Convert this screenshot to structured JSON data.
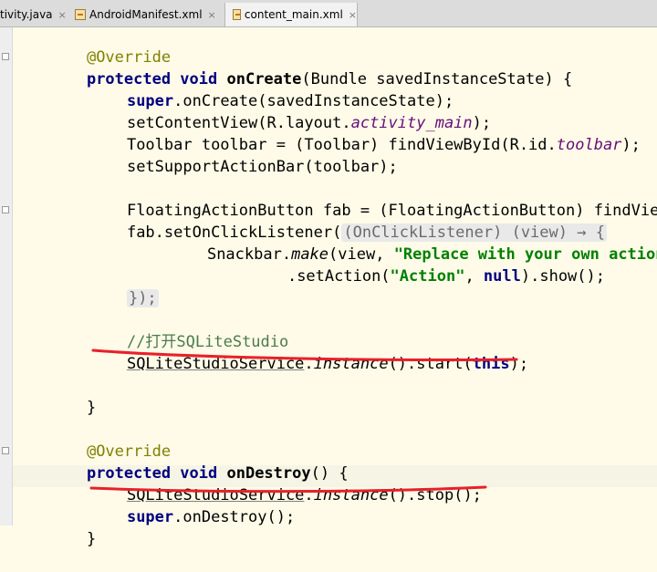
{
  "tabs": [
    {
      "label": "tivity.java",
      "icon": "java-file-icon",
      "active": false
    },
    {
      "label": "AndroidManifest.xml",
      "icon": "xml-file-icon",
      "active": false
    },
    {
      "label": "content_main.xml",
      "icon": "xml-file-icon",
      "active": true
    }
  ],
  "close_glyph": "×",
  "code": {
    "l1": "@Override",
    "l2_kw": "protected void ",
    "l2_name": "onCreate",
    "l2_rest": "(Bundle savedInstanceState) {",
    "l3_super": "super",
    "l3_rest": ".onCreate(savedInstanceState);",
    "l4_a": "setContentView(R.layout.",
    "l4_field": "activity_main",
    "l4_b": ");",
    "l5_a": "Toolbar toolbar = (Toolbar) findViewById(R.id.",
    "l5_field": "toolbar",
    "l5_b": ");",
    "l6": "setSupportActionBar(toolbar);",
    "l7": "FloatingActionButton fab = (FloatingActionButton) findViewBy",
    "l8_a": "fab.setOnClickListener(",
    "l8_hint": "(OnClickListener) (view) → {",
    "l9_a": "Snackbar.",
    "l9_make": "make",
    "l9_b": "(view, ",
    "l9_str": "\"Replace with your own action",
    "l10_a": ".setAction(",
    "l10_str": "\"Action\"",
    "l10_b": ", ",
    "l10_null": "null",
    "l10_c": ").show();",
    "l11": "});",
    "l12": "//打开SQLiteStudio",
    "l13_a": "SQLiteStudioService",
    "l13_b": ".",
    "l13_inst": "instance",
    "l13_c": "().start(",
    "l13_this": "this",
    "l13_d": ");",
    "l14": "}",
    "l15": "@Override",
    "l16_kw": "protected void ",
    "l16_name": "onDestroy",
    "l16_rest": "() {",
    "l17_a": "SQLiteStudioService",
    "l17_b": ".",
    "l17_inst": "instance",
    "l17_c": "().stop();",
    "l18_super": "super",
    "l18_rest": ".onDestroy();",
    "l19": "}"
  },
  "colors": {
    "annotation": "#808000",
    "keyword": "#000080",
    "string": "#008000",
    "field": "#660e7a",
    "comment": "#808080",
    "underline_mark": "#e8202a"
  }
}
